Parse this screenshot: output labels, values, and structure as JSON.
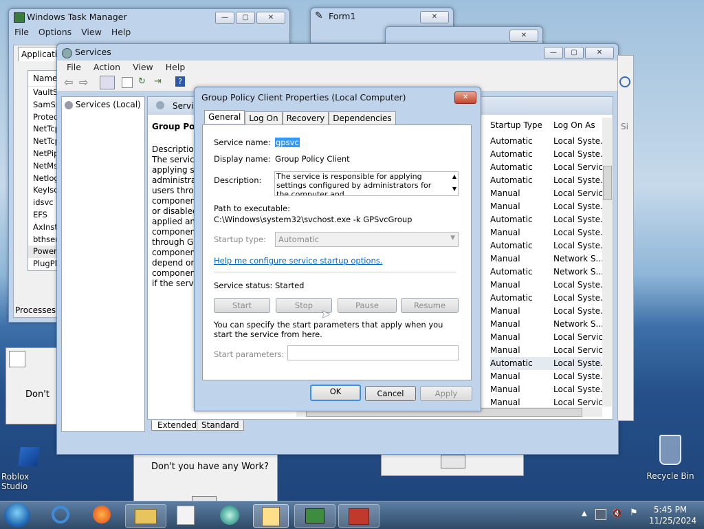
{
  "task_manager": {
    "title": "Windows Task Manager",
    "menu": [
      "File",
      "Options",
      "View",
      "Help"
    ],
    "tab": "Applicati",
    "column": "Name",
    "items": [
      "VaultSv",
      "SamSs",
      "Protec",
      "NetTcp",
      "NetTcp",
      "NetPip",
      "NetMs",
      "Netlog",
      "KeyIso",
      "idsvc",
      "EFS",
      "AxInst",
      "bthser",
      "Power",
      "PlugPla"
    ],
    "processes": "Processes: 3"
  },
  "form1": {
    "title": "Form1"
  },
  "services": {
    "title": "Services",
    "menu": [
      "File",
      "Action",
      "View",
      "Help"
    ],
    "tree_item": "Services (Local)",
    "header_label": "Servic",
    "detail_title": "Group Polic",
    "detail_lines": [
      "Description",
      "The service",
      "applying se",
      "administrat",
      "users throu",
      "component",
      "or disabled,",
      "applied and",
      "component",
      "through Gr",
      "component",
      "depend on",
      "component",
      "if the servic"
    ],
    "columns": {
      "startup": "Startup Type",
      "logon": "Log On As",
      "extra": "Si"
    },
    "rows": [
      [
        "Automatic",
        "Local Syste..."
      ],
      [
        "Automatic",
        "Local Syste..."
      ],
      [
        "Automatic",
        "Local Service"
      ],
      [
        "Automatic",
        "Local Syste..."
      ],
      [
        "Manual",
        "Local Service"
      ],
      [
        "Manual",
        "Local Syste..."
      ],
      [
        "Automatic",
        "Local Syste..."
      ],
      [
        "Manual",
        "Local Syste..."
      ],
      [
        "Automatic",
        "Local Syste..."
      ],
      [
        "Manual",
        "Network S..."
      ],
      [
        "Automatic",
        "Network S..."
      ],
      [
        "Manual",
        "Local Syste..."
      ],
      [
        "Automatic",
        "Local Syste..."
      ],
      [
        "Manual",
        "Local Syste..."
      ],
      [
        "Manual",
        "Network S..."
      ],
      [
        "Manual",
        "Local Service"
      ],
      [
        "Manual",
        "Local Service"
      ],
      [
        "Automatic",
        "Local Syste..."
      ],
      [
        "Manual",
        "Local Syste..."
      ],
      [
        "Manual",
        "Local Syste..."
      ],
      [
        "Manual",
        "Local Service"
      ]
    ],
    "tab_extended": "Extended",
    "tab_standard": "Standard"
  },
  "dialog": {
    "title": "Group Policy Client Properties (Local Computer)",
    "tabs": [
      "General",
      "Log On",
      "Recovery",
      "Dependencies"
    ],
    "service_name_label": "Service name:",
    "service_name_value": "gpsvc",
    "display_name_label": "Display name:",
    "display_name_value": "Group Policy Client",
    "description_label": "Description:",
    "description_value": "The service is responsible for applying settings configured by administrators for the computer and",
    "path_label": "Path to executable:",
    "path_value": "C:\\Windows\\system32\\svchost.exe -k GPSvcGroup",
    "startup_type_label": "Startup type:",
    "startup_type_value": "Automatic",
    "help_link": "Help me configure service startup options.",
    "status_label": "Service status:",
    "status_value": "Started",
    "buttons": {
      "start": "Start",
      "stop": "Stop",
      "pause": "Pause",
      "resume": "Resume"
    },
    "hint": "You can specify the start parameters that apply when you start the service from here.",
    "start_params_label": "Start parameters:",
    "ok": "OK",
    "cancel": "Cancel",
    "apply": "Apply"
  },
  "background": {
    "dont_short": "Don't",
    "dont_full": "Don't you have any Work?"
  },
  "desktop": {
    "roblox": "Roblox Studio",
    "recycle": "Recycle Bin"
  },
  "taskbar": {
    "time": "5:45 PM",
    "date": "11/25/2024"
  }
}
